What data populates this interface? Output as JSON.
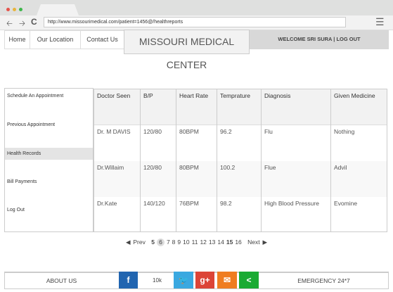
{
  "browser": {
    "url": "http://www.missourimedical.com/patient=1456@/healthreports",
    "dot_colors": [
      "#e5534b",
      "#e8b43c",
      "#3cb64a"
    ]
  },
  "nav": {
    "items": [
      "Home",
      "Our Location",
      "Contact Us"
    ],
    "title": "MISSOURI MEDICAL CENTER",
    "welcome": "WELCOME SRI SURA | LOG OUT"
  },
  "sidebar": {
    "items": [
      "Schedule An  Appointment",
      "Previous Appointment",
      "Health Records",
      "Bill Payments",
      "Log Out"
    ],
    "active": "Health Records"
  },
  "table": {
    "headers": [
      "Doctor Seen",
      "B/P",
      "Heart Rate",
      "Temprature",
      "Diagnosis",
      "Given Medicine"
    ],
    "rows": [
      [
        "Dr. M DAVIS",
        "120/80",
        "80BPM",
        "96.2",
        "Flu",
        "Nothing"
      ],
      [
        "Dr.Willaim",
        "120/80",
        "80BPM",
        "100.2",
        "Flue",
        "Advil"
      ],
      [
        "Dr.Kate",
        "140/120",
        "76BPM",
        "98.2",
        "High Blood Pressure",
        "Evomine"
      ]
    ]
  },
  "pagination": {
    "prev": "Prev",
    "next": "Next",
    "pages": [
      "5",
      "6",
      "7",
      "8",
      "9",
      "10",
      "11",
      "12",
      "13",
      "14",
      "15",
      "16"
    ],
    "current": "6"
  },
  "footer": {
    "about": "ABOUT US",
    "emergency": "EMERGENCY 24*7",
    "share_count": "10k",
    "social": {
      "facebook": "f",
      "twitter": "t",
      "google": "g+"
    }
  }
}
